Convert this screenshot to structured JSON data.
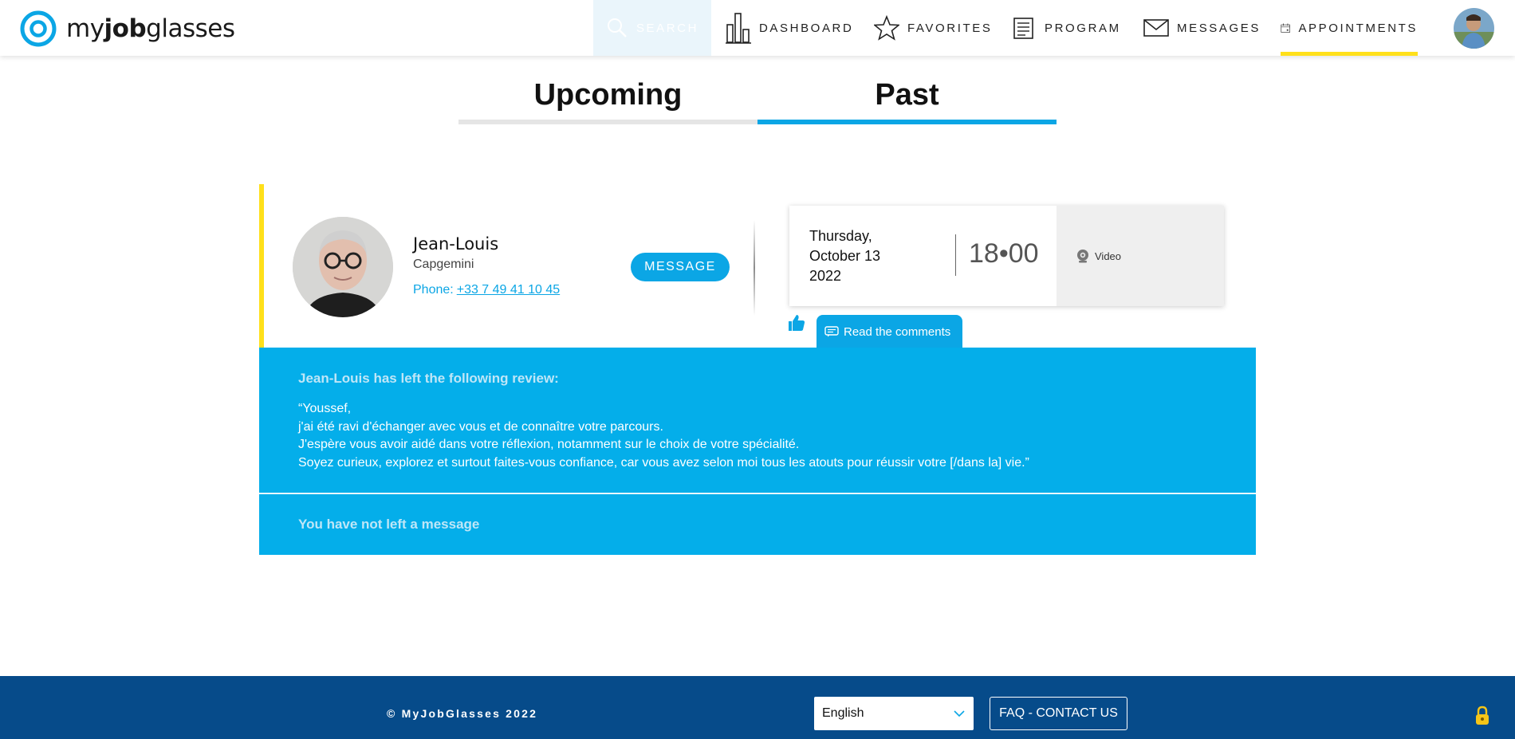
{
  "brand": {
    "name_light": "my",
    "name_bold": "job",
    "name_rest": "glasses",
    "accent": "#0ba6e5",
    "highlight": "#ffe01a"
  },
  "nav": {
    "search": {
      "label": "SEARCH",
      "icon": "search-icon"
    },
    "dashboard": {
      "label": "DASHBOARD",
      "icon": "bar-chart-icon"
    },
    "favorites": {
      "label": "FAVORITES",
      "icon": "star-icon"
    },
    "program": {
      "label": "PROGRAM",
      "icon": "document-icon"
    },
    "messages": {
      "label": "MESSAGES",
      "icon": "envelope-icon"
    },
    "appointments": {
      "label": "APPOINTMENTS",
      "icon": "calendar-icon",
      "active": true
    }
  },
  "tabs": {
    "upcoming": "Upcoming",
    "past": "Past",
    "active": "past"
  },
  "appointment": {
    "name": "Jean-Louis",
    "company": "Capgemini",
    "phone_label": "Phone:",
    "phone": "+33 7 49 41 10 45",
    "message_button": "MESSAGE",
    "date_line1": "Thursday,",
    "date_line2": "October 13",
    "date_line3": "2022",
    "time": "18•00",
    "mode": "Video",
    "comments_label": "Read the comments"
  },
  "review": {
    "title": "Jean-Louis has left the following review:",
    "lines": [
      "“Youssef,",
      "j'ai été ravi d'échanger avec vous et de connaître votre parcours.",
      "J'espère vous avoir aidé dans votre réflexion, notamment sur le choix de votre spécialité.",
      "Soyez curieux, explorez et surtout faites-vous confiance, car vous avez selon moi tous les atouts pour réussir votre [/dans la] vie.”"
    ],
    "no_message": "You have not left a message"
  },
  "footer": {
    "copyright": "© MyJobGlasses  2022",
    "language": "English",
    "faq": "FAQ - CONTACT US",
    "bg": "#064b8a"
  }
}
